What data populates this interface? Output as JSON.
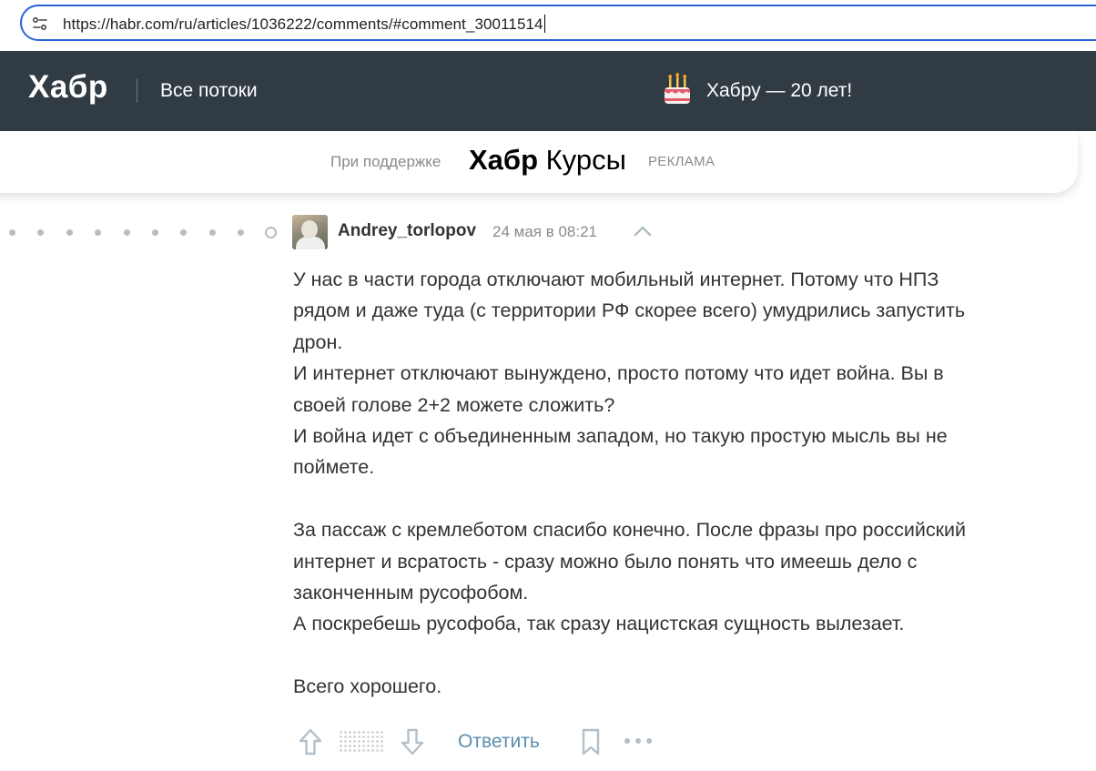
{
  "browser": {
    "url": "https://habr.com/ru/articles/1036222/comments/#comment_30011514"
  },
  "header": {
    "logo": "Хабр",
    "nav_all_flows": "Все потоки",
    "anniversary": "Хабру — 20 лет!"
  },
  "sponsor": {
    "label": "При поддержке",
    "logo_bold": "Хабр",
    "logo_rest": " Курсы",
    "ad_label": "РЕКЛАМА"
  },
  "comment": {
    "author": "Andrey_torlopov",
    "timestamp": "24 мая в 08:21",
    "paragraphs": [
      "У нас в части города отключают мобильный интернет. Потому что НПЗ",
      "рядом и даже туда (с территории РФ скорее всего) умудрились запустить",
      "дрон.",
      "И интернет отключают вынуждено, просто потому что идет война. Вы в",
      "своей голове 2+2 можете сложить?",
      "И война идет с объединенным западом, но такую простую мысль вы не",
      "поймете.",
      "",
      "За пассаж с кремлеботом спасибо конечно. После фразы про российский",
      "интернет и всратость - сразу можно было понять что имеешь дело с",
      "законченным русофобом.",
      "А поскребешь русофоба, так сразу нацистская сущность вылезает.",
      "",
      "Всего хорошего."
    ],
    "reply_label": "Ответить"
  },
  "icons": {
    "address_bar": "site-info-icon",
    "anniversary": "cake-icon",
    "collapse": "chevron-up-icon",
    "vote_up": "arrow-up-icon",
    "vote_down": "arrow-down-icon",
    "bookmark": "bookmark-icon",
    "more": "more-dots-icon"
  },
  "colors": {
    "header_bg": "#303b44",
    "link": "#5a8db0",
    "address_border": "#2b63d6"
  }
}
